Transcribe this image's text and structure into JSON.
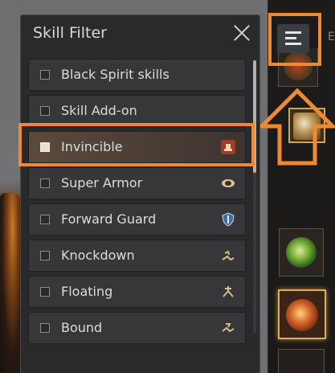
{
  "panel": {
    "title": "Skill Filter",
    "close_icon": "close-icon"
  },
  "filters": [
    {
      "label": "Black Spirit skills",
      "checked": false,
      "icon": null
    },
    {
      "label": "Skill Add-on",
      "checked": false,
      "icon": null
    },
    {
      "label": "Invincible",
      "checked": true,
      "icon": "invincible-icon",
      "icon_color": "#a43a2a"
    },
    {
      "label": "Super Armor",
      "checked": false,
      "icon": "super-armor-icon",
      "icon_color": "#d8c59a"
    },
    {
      "label": "Forward Guard",
      "checked": false,
      "icon": "forward-guard-icon",
      "icon_color": "#3b6ea8"
    },
    {
      "label": "Knockdown",
      "checked": false,
      "icon": "knockdown-icon",
      "icon_color": "#d6c08a"
    },
    {
      "label": "Floating",
      "checked": false,
      "icon": "floating-icon",
      "icon_color": "#d6c08a"
    },
    {
      "label": "Bound",
      "checked": false,
      "icon": "bound-icon",
      "icon_color": "#d6c08a"
    }
  ],
  "sidebar": {
    "filter_toggle_icon": "filter-list-icon",
    "partial_letter": "E"
  },
  "annotations": {
    "highlight_color": "#ef8a33"
  }
}
